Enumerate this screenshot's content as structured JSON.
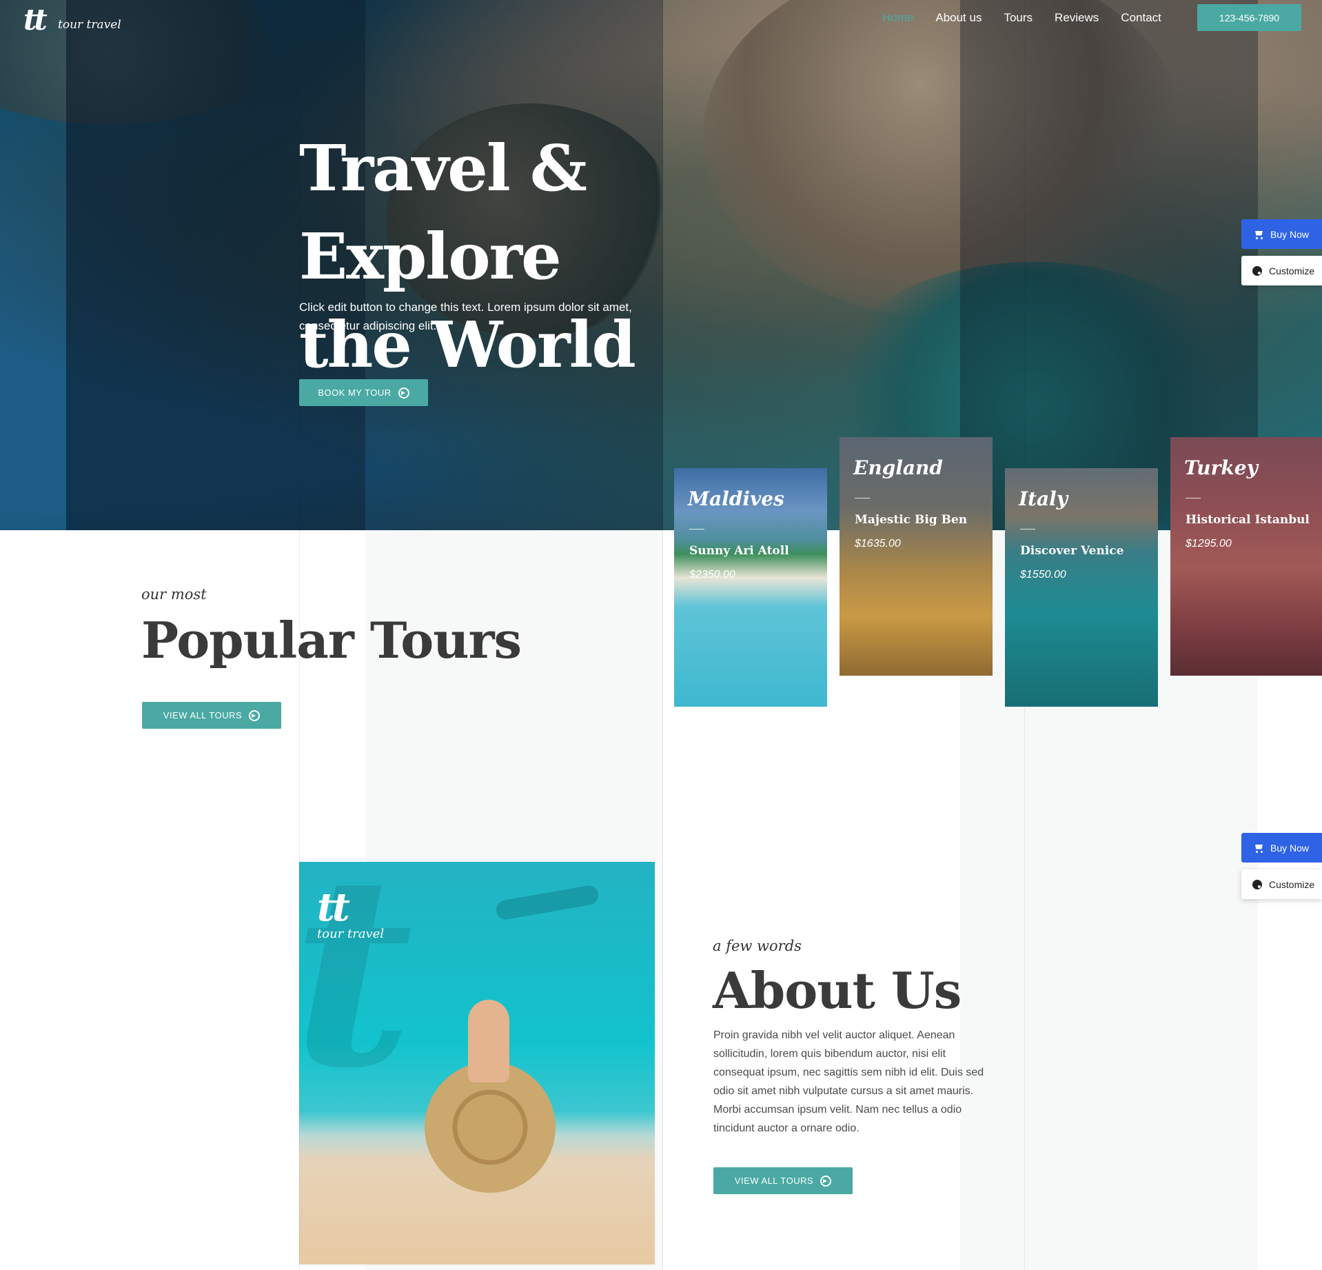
{
  "brand": {
    "mark": "tt",
    "name": "tour travel"
  },
  "nav": {
    "items": [
      "Home",
      "About us",
      "Tours",
      "Reviews",
      "Contact"
    ],
    "active": "Home",
    "phone": "123-456-7890"
  },
  "hero": {
    "title_line1": "Travel & Explore",
    "title_line2": "the World",
    "subtitle": "Click edit button to change this text. Lorem ipsum dolor sit amet, consectetur adipiscing elit.",
    "cta": "BOOK MY TOUR"
  },
  "side_widget": {
    "buy": "Buy Now",
    "customize": "Customize"
  },
  "tours": [
    {
      "country": "Maldives",
      "name": "Sunny Ari Atoll",
      "price": "$2350.00"
    },
    {
      "country": "England",
      "name": "Majestic Big Ben",
      "price": "$1635.00"
    },
    {
      "country": "Italy",
      "name": "Discover Venice",
      "price": "$1550.00"
    },
    {
      "country": "Turkey",
      "name": "Historical Istanbul",
      "price": "$1295.00"
    }
  ],
  "popular": {
    "eyebrow": "our most",
    "title": "Popular Tours",
    "cta": "VIEW ALL TOURS"
  },
  "about": {
    "eyebrow": "a few words",
    "title": "About Us",
    "body": "Proin gravida nibh vel velit auctor aliquet. Aenean sollicitudin, lorem quis bibendum auctor, nisi elit consequat ipsum, nec sagittis sem nibh id elit. Duis sed odio sit amet nibh vulputate cursus a sit amet mauris. Morbi accumsan ipsum velit. Nam nec tellus a odio tincidunt auctor a ornare odio.",
    "cta": "VIEW ALL TOURS",
    "image_logo_mark": "tt",
    "image_logo_text": "tour travel"
  },
  "colors": {
    "accent": "#4aa9a3",
    "buy": "#2f63e6",
    "dark_text": "#3a3a3a"
  }
}
